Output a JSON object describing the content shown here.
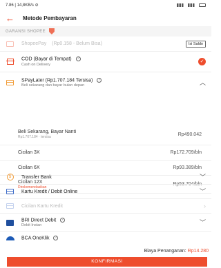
{
  "status_bar": {
    "time": "7.86 | 14,8KB/s ⊘"
  },
  "header": {
    "title": "Metode Pembayaran"
  },
  "guarantee": {
    "label": "GARANSI SHOPEE"
  },
  "methods": [
    {
      "title": "ShopeePay",
      "sub": "(Rp0.158 - Belum Bisa)",
      "trailing_label": "Isi Saldo",
      "disabled": true
    },
    {
      "title": "COD (Bayar di Tempat)",
      "sub": "Cash on Delivery",
      "selected": true
    },
    {
      "title": "SPayLater (Rp1.707.184 Tersisa)",
      "sub": "Beli sekarang dan bayar bulan depan",
      "expanded": true
    }
  ],
  "installments": [
    {
      "label": "Beli Sekarang, Bayar Nanti",
      "sub": "Rp1.707.184 · tersisa",
      "price": "Rp490.042"
    },
    {
      "label": "Cicilan 3X",
      "sub": "",
      "price": "Rp172.709/bln"
    },
    {
      "label": "Cicilan 6X",
      "sub": "",
      "price": "Rp93.389/bln"
    },
    {
      "label": "Cicilan 12X",
      "sub": "Direkomendasikan",
      "price": "Rp53.704/bln"
    }
  ],
  "more_methods": [
    {
      "title": "Transfer Bank",
      "sub": ""
    },
    {
      "title": "Kartu Kredit / Debit Online",
      "sub": ""
    },
    {
      "title": "Cicilan Kartu Kredit",
      "sub": ""
    },
    {
      "title": "BRI Direct Debit",
      "sub": "Debit Instan"
    },
    {
      "title": "BCA OneKlik",
      "sub": ""
    }
  ],
  "footer": {
    "fee_label": "Biaya Penanganan:",
    "fee_value": "Rp14.280",
    "confirm_label": "KONFIRMASI"
  },
  "colors": {
    "accent": "#ee4d2d",
    "paylater": "#f19c38",
    "bank_blue": "#1f4f9e"
  }
}
